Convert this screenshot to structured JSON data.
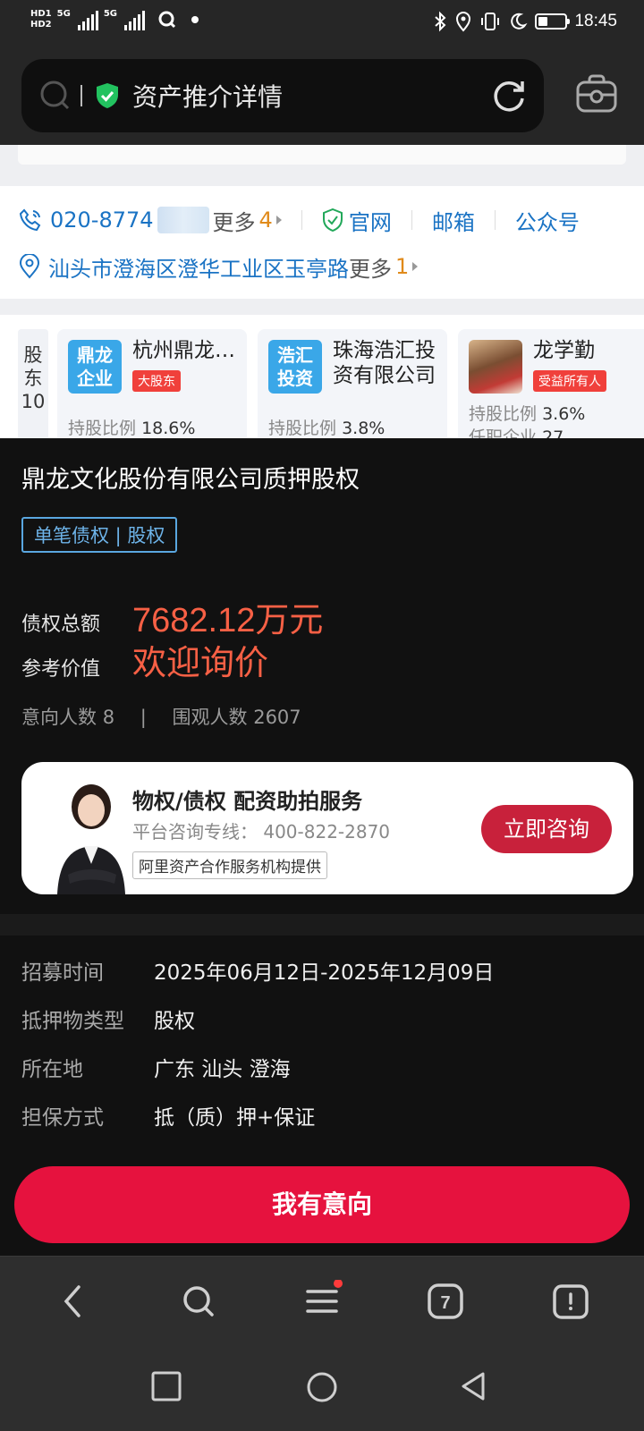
{
  "status_bar": {
    "hd1": "HD1",
    "hd2": "HD2",
    "net1": "5G",
    "net2": "5G",
    "time": "18:45",
    "battery_level": 0.35
  },
  "address_bar": {
    "title": "资产推介详情"
  },
  "contact": {
    "phone": "020-8774",
    "more_label": "更多",
    "more_count": "4",
    "website": "官网",
    "email": "邮箱",
    "wechat": "公众号",
    "address": "汕头市澄海区澄华工业区玉亭路",
    "address_more_label": "更多",
    "address_more_count": "1"
  },
  "shareholders": {
    "label": "股东10",
    "label_line1": "股",
    "label_line2": "东",
    "label_line3": "10",
    "items": [
      {
        "logo_text_1": "鼎龙",
        "logo_text_2": "企业",
        "name": "杭州鼎龙…",
        "tag": "大股东",
        "stat_label": "持股比例",
        "stat_value": "18.6%"
      },
      {
        "logo_text_1": "浩汇",
        "logo_text_2": "投资",
        "name": "珠海浩汇投资有限公司",
        "tag": "",
        "stat_label": "持股比例",
        "stat_value": "3.8%"
      },
      {
        "logo_text_1": "",
        "logo_text_2": "",
        "name": "龙学勤",
        "tag": "受益所有人",
        "stat_label": "持股比例",
        "stat_value": "3.6%",
        "stat2_label": "任职企业",
        "stat2_value": "27"
      }
    ]
  },
  "asset": {
    "title": "鼎龙文化股份有限公司质押股权",
    "tag": "单笔债权 | 股权",
    "total_label": "债权总额",
    "total_value": "7682.12万元",
    "ref_label": "参考价值",
    "ref_value": "欢迎询价",
    "interested_label": "意向人数",
    "interested_count": "8",
    "divider": "|",
    "watchers_label": "围观人数",
    "watchers_count": "2607"
  },
  "service": {
    "title": "物权/债权  配资助拍服务",
    "hotline": "平台咨询专线： 400-822-2870",
    "provider": "阿里资产合作服务机构提供",
    "button": "立即咨询"
  },
  "details": {
    "rows": [
      {
        "key": "招募时间",
        "value": "2025年06月12日-2025年12月09日"
      },
      {
        "key": "抵押物类型",
        "value": "股权"
      },
      {
        "key": "所在地",
        "value": "广东 汕头 澄海"
      },
      {
        "key": "担保方式",
        "value": "抵（质）押+保证"
      }
    ],
    "cta": "我有意向"
  },
  "toolbar": {
    "tab_count": "7"
  },
  "colors": {
    "accent_red": "#e6123e",
    "price_orange": "#f76045",
    "link_blue": "#1a73c4",
    "tag_blue": "#6db3e8"
  },
  "icons": [
    "search-icon",
    "shield-check-icon",
    "reload-icon",
    "bag-icon",
    "phone-icon",
    "location-icon",
    "back-icon",
    "menu-icon",
    "tabs-icon",
    "home-icon"
  ]
}
